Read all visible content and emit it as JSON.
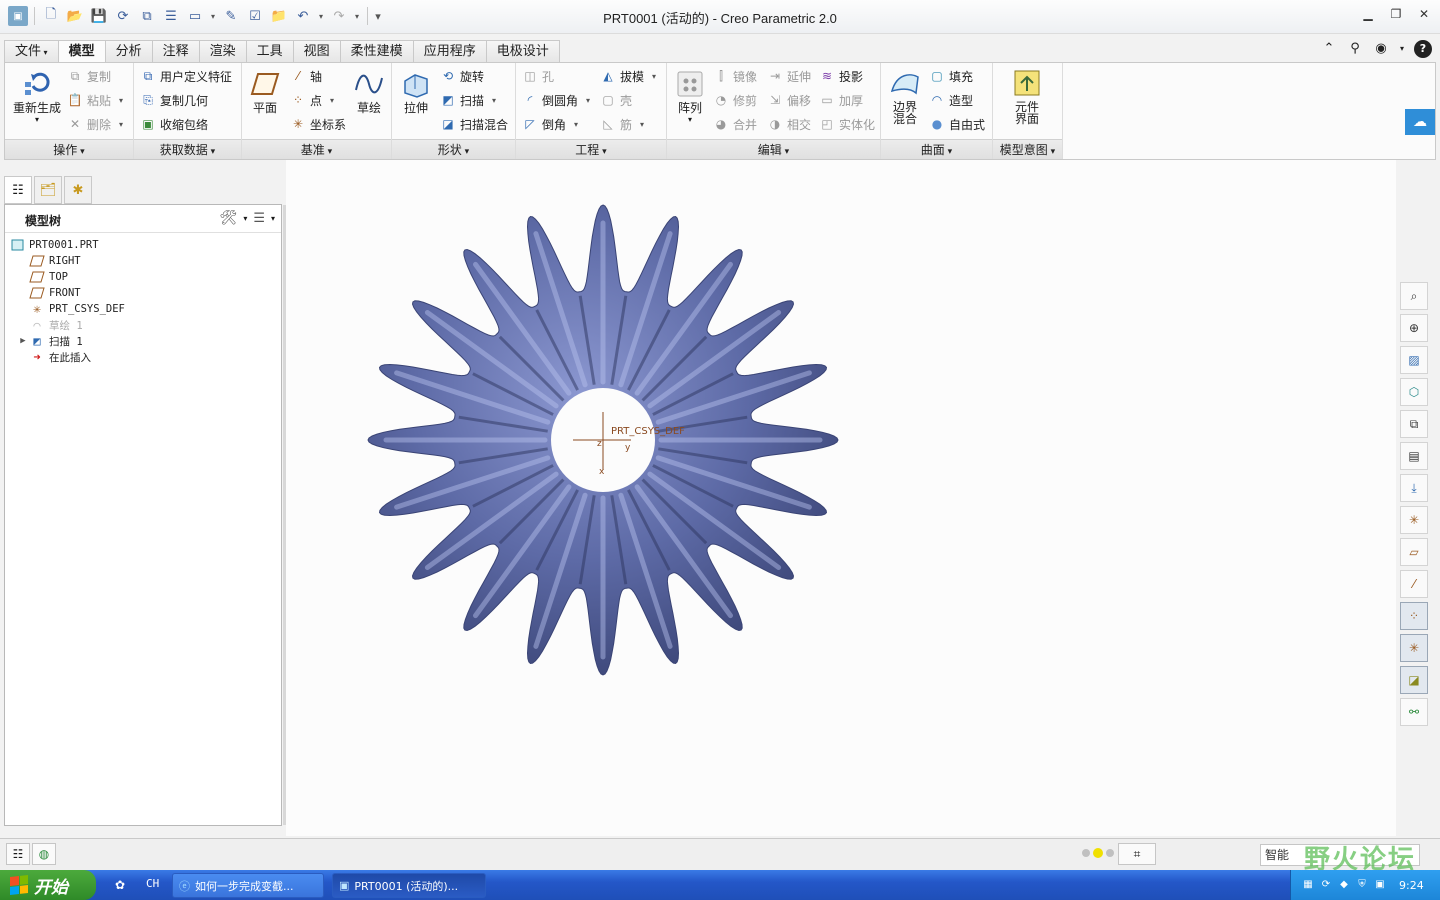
{
  "window": {
    "title": "PRT0001 (活动的) - Creo Parametric 2.0",
    "minimize": "▁",
    "maximize": "❐",
    "close": "✕"
  },
  "quick_access": [
    "new-icon",
    "open-icon",
    "save-icon",
    "regenerate-icon",
    "copy-icon",
    "model-tree-icon",
    "window-icon",
    "edit-icon",
    "check-icon",
    "folder-icon",
    "undo-icon",
    "redo-icon",
    "customize-icon"
  ],
  "tabs": [
    {
      "label": "文件",
      "has_dropdown": true
    },
    {
      "label": "模型",
      "active": true
    },
    {
      "label": "分析"
    },
    {
      "label": "注释"
    },
    {
      "label": "渲染"
    },
    {
      "label": "工具"
    },
    {
      "label": "视图"
    },
    {
      "label": "柔性建模"
    },
    {
      "label": "应用程序"
    },
    {
      "label": "电极设计"
    }
  ],
  "ribbon": {
    "operations": {
      "group_label": "操作",
      "regenerate": "重新生成",
      "copy": "复制",
      "paste": "粘贴",
      "delete": "删除"
    },
    "get_data": {
      "group_label": "获取数据",
      "user_defined_feature": "用户定义特征",
      "copy_geometry": "复制几何",
      "shrinkwrap": "收缩包络"
    },
    "datum": {
      "group_label": "基准",
      "plane": "平面",
      "axis": "轴",
      "point": "点",
      "csys": "坐标系",
      "sketch": "草绘"
    },
    "shapes": {
      "group_label": "形状",
      "extrude": "拉伸",
      "revolve": "旋转",
      "sweep": "扫描",
      "swept_blend": "扫描混合"
    },
    "engineering": {
      "group_label": "工程",
      "hole": "孔",
      "round": "倒圆角",
      "chamfer": "倒角",
      "draft": "拔模",
      "shell": "壳",
      "rib": "筋"
    },
    "editing": {
      "group_label": "编辑",
      "pattern": "阵列",
      "mirror": "镜像",
      "trim": "修剪",
      "merge": "合并",
      "extend": "延伸",
      "offset": "偏移",
      "intersect": "相交",
      "project": "投影",
      "thicken": "加厚",
      "solidify": "实体化"
    },
    "surfaces": {
      "group_label": "曲面",
      "boundary_blend": "边界\n混合",
      "fill": "填充",
      "style": "造型",
      "freestyle": "自由式"
    },
    "model_intent": {
      "group_label": "模型意图",
      "component_interface": "元件\n界面"
    }
  },
  "model_tree": {
    "title": "模型树",
    "nodes": [
      {
        "label": "PRT0001.PRT",
        "icon": "part-icon",
        "indent": 0
      },
      {
        "label": "RIGHT",
        "icon": "datum-plane-icon",
        "indent": 1
      },
      {
        "label": "TOP",
        "icon": "datum-plane-icon",
        "indent": 1
      },
      {
        "label": "FRONT",
        "icon": "datum-plane-icon",
        "indent": 1
      },
      {
        "label": "PRT_CSYS_DEF",
        "icon": "csys-icon",
        "indent": 1
      },
      {
        "label": "草绘 1",
        "icon": "sketch-icon",
        "indent": 1,
        "faded": true
      },
      {
        "label": "扫描 1",
        "icon": "sweep-icon",
        "indent": 1,
        "expandable": true
      },
      {
        "label": "在此插入",
        "icon": "insert-here-icon",
        "indent": 1
      }
    ]
  },
  "graphics": {
    "csys_label": "PRT_CSYS_DEF",
    "axis_x": "x",
    "axis_y": "y",
    "axis_z": "z",
    "model_color": "#5d6aa6",
    "background_color": "#fcfcfc"
  },
  "right_toolbar": [
    "refit-icon",
    "zoom-in-icon",
    "repaint-icon",
    "view-orientation-icon",
    "saved-views-icon",
    "display-style-icon",
    "spin-center-icon",
    "csys-display-icon",
    "plane-display-icon",
    "axis-display-icon",
    "point-display-icon",
    "csys-tag-icon",
    "annotation-display-icon",
    "network-icon"
  ],
  "status_bar": {
    "filter_value": "智能",
    "watermark": "野火论坛"
  },
  "taskbar": {
    "start_label": "开始",
    "lang": "CH",
    "tasks": [
      {
        "label": "如何一步完成变截...",
        "icon": "ie-icon"
      },
      {
        "label": "PRT0001 (活动的)...",
        "icon": "creo-icon",
        "active": true
      }
    ],
    "clock": "9:24"
  }
}
